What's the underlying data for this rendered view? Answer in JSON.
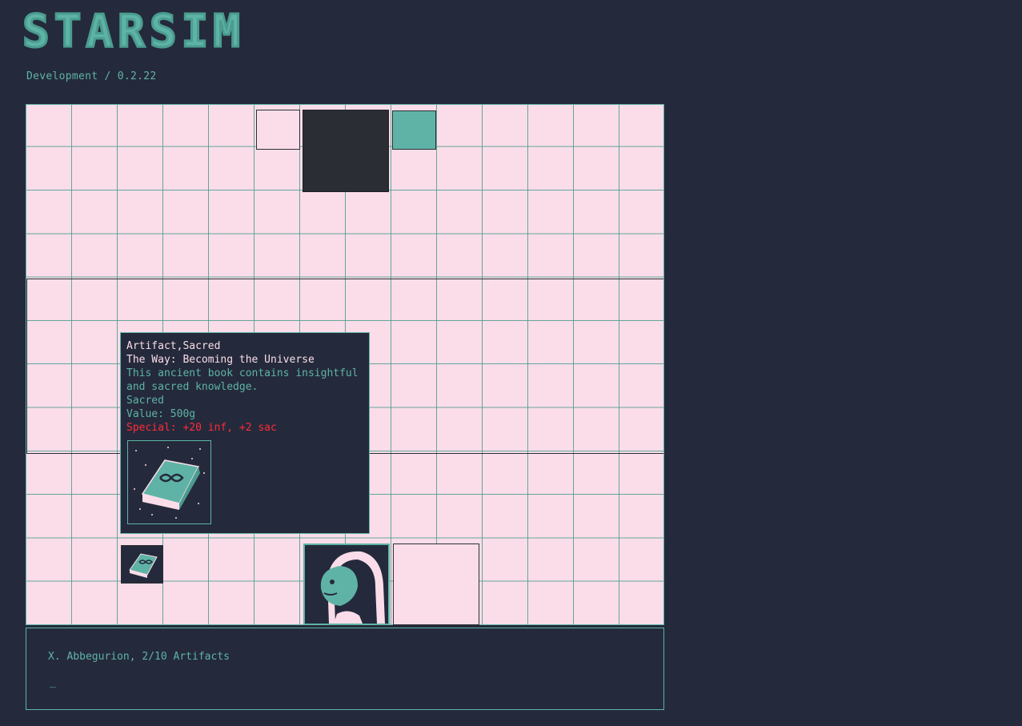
{
  "app": {
    "logo_text": "STARSIM",
    "version_label": "Development / 0.2.22"
  },
  "colors": {
    "background": "#242a3b",
    "accent_teal": "#5fb3a6",
    "cell_pink": "#fbdde9",
    "dark_slot": "#2a2d33",
    "special_red": "#ff2a3a"
  },
  "tooltip": {
    "type_line": "Artifact,Sacred",
    "name": "The Way: Becoming the Universe",
    "description_line1": "This ancient book contains insightful",
    "description_line2": "and sacred knowledge.",
    "category": "Sacred",
    "value": "Value: 500g",
    "special": "Special: +20 inf, +2 sac",
    "image_icon": "sacred-book-icon"
  },
  "board_slots": [
    {
      "name": "slot-empty-small",
      "icon": null
    },
    {
      "name": "slot-dark",
      "icon": null
    },
    {
      "name": "slot-teal",
      "icon": null
    },
    {
      "name": "slot-artifact-book",
      "icon": "sacred-book-icon"
    },
    {
      "name": "slot-character-portrait",
      "icon": "hooded-alien-portrait-icon"
    },
    {
      "name": "slot-empty-large",
      "icon": null
    }
  ],
  "status": {
    "character_line": "X. Abbegurion, 2/10 Artifacts",
    "cursor": "_"
  }
}
